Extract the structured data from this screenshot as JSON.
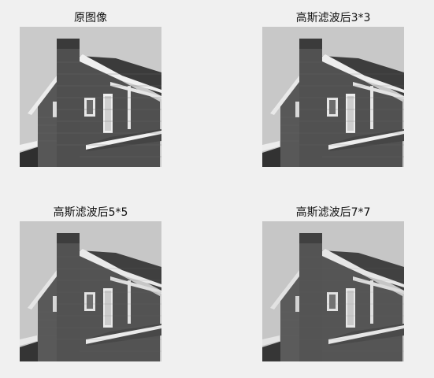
{
  "figure": {
    "panels": [
      {
        "title": "原图像"
      },
      {
        "title": "高斯滤波后3*3"
      },
      {
        "title": "高斯滤波后5*5"
      },
      {
        "title": "高斯滤波后7*7"
      }
    ]
  },
  "colors": {
    "background": "#f0f0f0",
    "sky": "#c9c9c9",
    "brick": "#5a5a5a",
    "roof": "#3f3f3f",
    "trim": "#f2f2f2"
  }
}
